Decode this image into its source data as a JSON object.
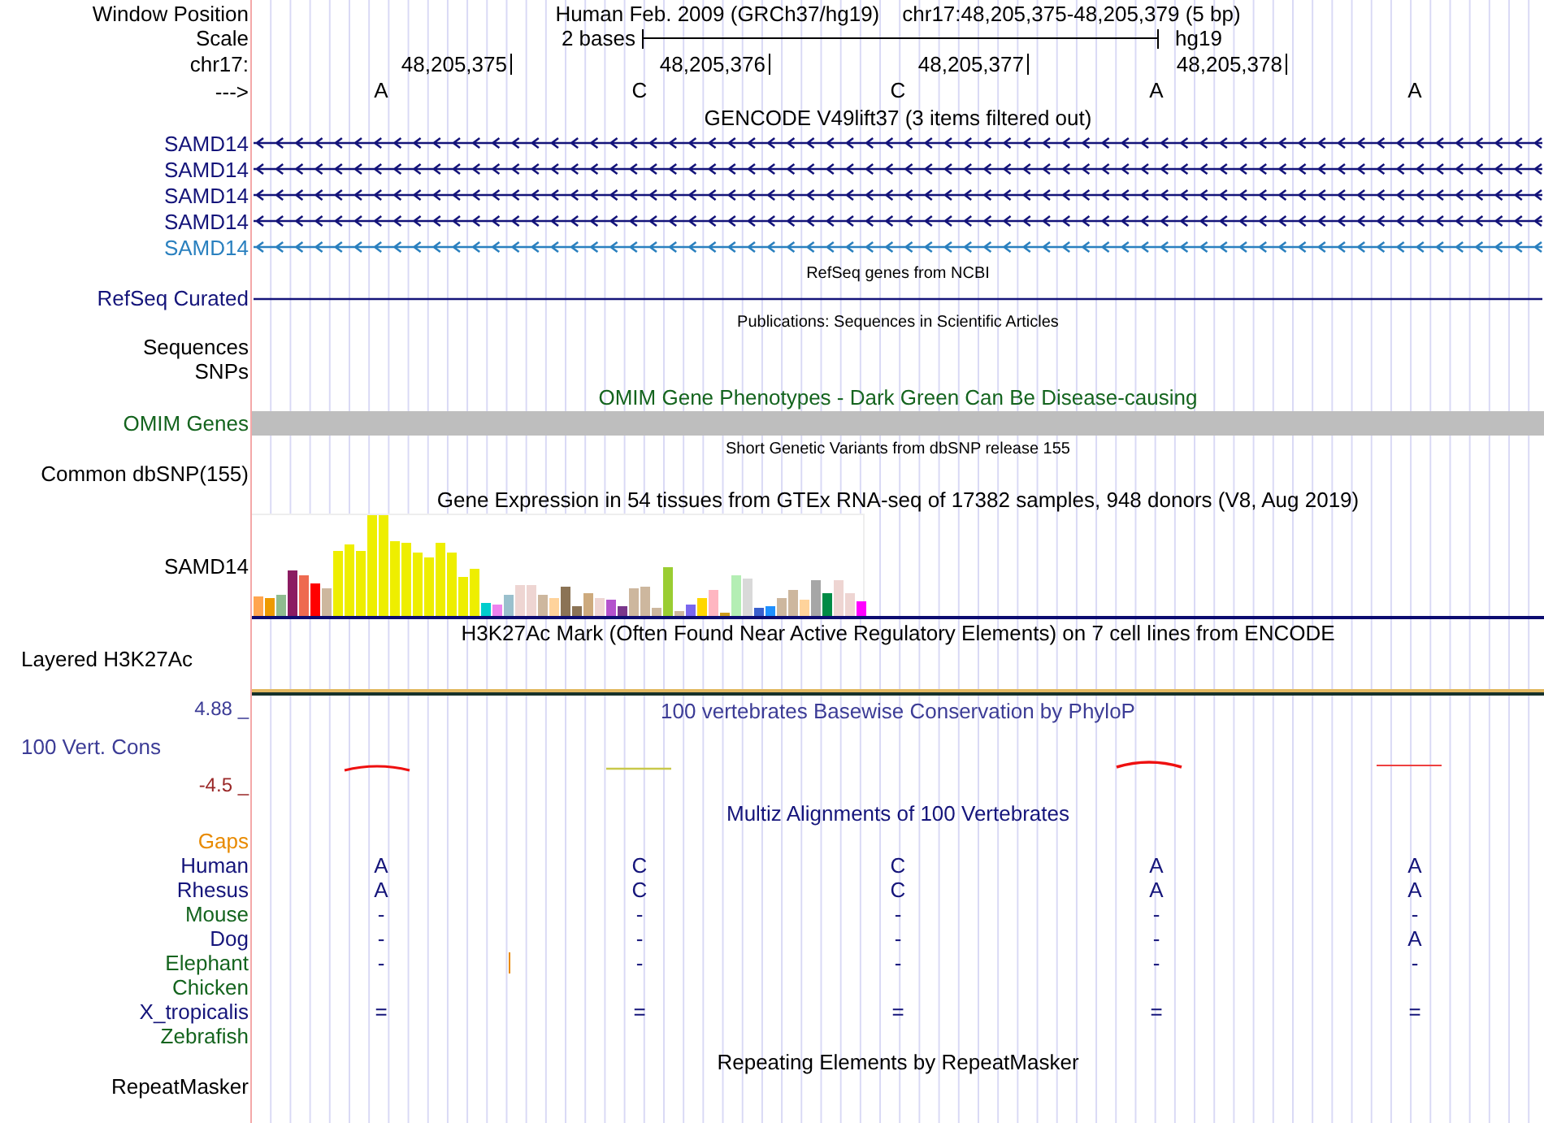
{
  "header": {
    "window_position_label": "Window Position",
    "assembly": "Human Feb. 2009 (GRCh37/hg19)",
    "position": "chr17:48,205,375-48,205,379 (5 bp)",
    "scale_label": "Scale",
    "scale_text": "2 bases",
    "scale_assembly": "hg19",
    "chrom_label": "chr17:",
    "ruler_ticks": [
      "48,205,375",
      "48,205,376",
      "48,205,377",
      "48,205,378"
    ],
    "strand_label": "--->",
    "bases": [
      "A",
      "C",
      "C",
      "A",
      "A"
    ]
  },
  "tracks": [
    {
      "kind": "gene",
      "title": {
        "text": "GENCODE V49lift37 (3 items filtered out)",
        "color": "#000000",
        "kind": "large"
      },
      "items": [
        {
          "label": "SAMD14",
          "color": "#14147a",
          "arrows": true
        },
        {
          "label": "SAMD14",
          "color": "#14147a",
          "arrows": true
        },
        {
          "label": "SAMD14",
          "color": "#14147a",
          "arrows": true
        },
        {
          "label": "SAMD14",
          "color": "#14147a",
          "arrows": true
        },
        {
          "label": "SAMD14",
          "color": "#2a80bf",
          "arrows": true
        }
      ]
    },
    {
      "kind": "gene",
      "title": {
        "text": "RefSeq genes from NCBI",
        "color": "#000000",
        "kind": "small"
      },
      "items": [
        {
          "label": "RefSeq Curated",
          "color": "#14147a",
          "arrows": false
        }
      ]
    },
    {
      "kind": "labels",
      "title": {
        "text": "Publications: Sequences in Scientific Articles",
        "color": "#000000",
        "kind": "small"
      },
      "labels": [
        "Sequences",
        "SNPs"
      ]
    },
    {
      "kind": "omim",
      "title": {
        "text": "OMIM Gene Phenotypes - Dark Green Can Be Disease-causing",
        "color": "#14641e",
        "kind": "large"
      },
      "label": {
        "text": "OMIM Genes",
        "color": "#14641e"
      }
    },
    {
      "kind": "labels",
      "title": {
        "text": "Short Genetic Variants from dbSNP release 155",
        "color": "#000000",
        "kind": "small"
      },
      "labels": [
        "Common dbSNP(155)"
      ]
    },
    {
      "kind": "expression",
      "title": {
        "text": "Gene Expression in 54 tissues from GTEx RNA-seq of 17382 samples, 948 donors (V8, Aug 2019)",
        "color": "#000000",
        "kind": "large"
      },
      "label": "SAMD14"
    },
    {
      "kind": "layered",
      "title": {
        "text": "H3K27Ac Mark (Often Found Near Active Regulatory Elements) on 7 cell lines from ENCODE",
        "color": "#000000",
        "kind": "large"
      },
      "label": "Layered H3K27Ac"
    },
    {
      "kind": "conservation",
      "title": {
        "text": "100 vertebrates Basewise Conservation by PhyloP",
        "color": "#3c3c96",
        "kind": "large"
      },
      "label": {
        "text": "100 Vert. Cons",
        "color": "#3c3c96"
      },
      "max": {
        "text": "4.88 _",
        "color": "#3c3c96"
      },
      "min": {
        "text": "-4.5 _",
        "color": "#9a2828"
      }
    },
    {
      "kind": "multiz",
      "title": {
        "text": "Multiz Alignments of 100 Vertebrates",
        "color": "#14147a",
        "kind": "large"
      },
      "rows": [
        {
          "label": "Gaps",
          "color": "#e88a00",
          "insertion": false
        },
        {
          "label": "Human",
          "color": "#14147a",
          "bases": [
            "A",
            "C",
            "C",
            "A",
            "A"
          ],
          "insertion": false
        },
        {
          "label": "Rhesus",
          "color": "#14147a",
          "bases": [
            "A",
            "C",
            "C",
            "A",
            "A"
          ],
          "insertion": false
        },
        {
          "label": "Mouse",
          "color": "#14641e",
          "bases": [
            "-",
            "-",
            "-",
            "-",
            "-"
          ],
          "insertion": false
        },
        {
          "label": "Dog",
          "color": "#14147a",
          "bases": [
            "-",
            "-",
            "-",
            "-",
            "A"
          ],
          "insertion": false
        },
        {
          "label": "Elephant",
          "color": "#14641e",
          "bases": [
            "-",
            "-",
            "-",
            "-",
            "-"
          ],
          "insertion": true
        },
        {
          "label": "Chicken",
          "color": "#14641e",
          "insertion": false
        },
        {
          "label": "X_tropicalis",
          "color": "#14147a",
          "bases": [
            "=",
            "=",
            "=",
            "=",
            "="
          ],
          "insertion": false
        },
        {
          "label": "Zebrafish",
          "color": "#14641e",
          "insertion": false
        }
      ]
    },
    {
      "kind": "labels",
      "title": {
        "text": "Repeating Elements by RepeatMasker",
        "color": "#000000",
        "kind": "large"
      },
      "labels": [
        "RepeatMasker"
      ]
    }
  ]
}
